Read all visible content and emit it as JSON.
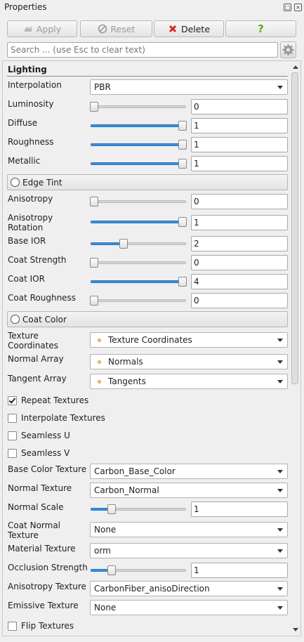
{
  "window": {
    "title": "Properties"
  },
  "toolbar": {
    "apply_label": "Apply",
    "reset_label": "Reset",
    "delete_label": "Delete",
    "help_label": "?"
  },
  "search": {
    "placeholder": "Search ... (use Esc to clear text)"
  },
  "section": {
    "title": "Lighting"
  },
  "fields": {
    "interpolation": {
      "label": "Interpolation",
      "value": "PBR"
    },
    "luminosity": {
      "label": "Luminosity",
      "value": "0",
      "level": 0.0
    },
    "diffuse": {
      "label": "Diffuse",
      "value": "1",
      "level": 1.0
    },
    "roughness": {
      "label": "Roughness",
      "value": "1",
      "level": 1.0
    },
    "metallic": {
      "label": "Metallic",
      "value": "1",
      "level": 1.0
    },
    "edge_tint": {
      "label": "Edge Tint"
    },
    "anisotropy": {
      "label": "Anisotropy",
      "value": "0",
      "level": 0.0
    },
    "anisotropy_rotation": {
      "label1": "Anisotropy",
      "label2": "Rotation",
      "value": "1",
      "level": 1.0
    },
    "base_ior": {
      "label": "Base IOR",
      "value": "2",
      "level": 0.33
    },
    "coat_strength": {
      "label": "Coat Strength",
      "value": "0",
      "level": 0.0
    },
    "coat_ior": {
      "label": "Coat IOR",
      "value": "4",
      "level": 1.0
    },
    "coat_roughness": {
      "label": "Coat Roughness",
      "value": "0",
      "level": 0.0
    },
    "coat_color": {
      "label": "Coat Color"
    },
    "texture_coordinates": {
      "label1": "Texture",
      "label2": "Coordinates",
      "value": "Texture Coordinates"
    },
    "normal_array": {
      "label": "Normal Array",
      "value": "Normals"
    },
    "tangent_array": {
      "label": "Tangent Array",
      "value": "Tangents"
    },
    "repeat_textures": {
      "label": "Repeat Textures",
      "checked": true
    },
    "interpolate_textures": {
      "label": "Interpolate Textures",
      "checked": false
    },
    "seamless_u": {
      "label": "Seamless U",
      "checked": false
    },
    "seamless_v": {
      "label": "Seamless V",
      "checked": false
    },
    "base_color_texture": {
      "label": "Base Color Texture",
      "value": "Carbon_Base_Color"
    },
    "normal_texture": {
      "label": "Normal Texture",
      "value": "Carbon_Normal"
    },
    "normal_scale": {
      "label": "Normal Scale",
      "value": "1",
      "level": 0.2
    },
    "coat_normal_texture": {
      "label1": "Coat Normal",
      "label2": "Texture",
      "value": "None"
    },
    "material_texture": {
      "label": "Material Texture",
      "value": "orm"
    },
    "occlusion_strength": {
      "label": "Occlusion Strength",
      "value": "1",
      "level": 0.2
    },
    "anisotropy_texture": {
      "label": "Anisotropy Texture",
      "value": "CarbonFiber_anisoDirection"
    },
    "emissive_texture": {
      "label": "Emissive Texture",
      "value": "None"
    },
    "flip_textures": {
      "label": "Flip Textures",
      "checked": false
    }
  },
  "colors": {
    "accent": "#3a8fd9",
    "delete_icon": "#d8262b",
    "help_icon": "#6aa521"
  }
}
